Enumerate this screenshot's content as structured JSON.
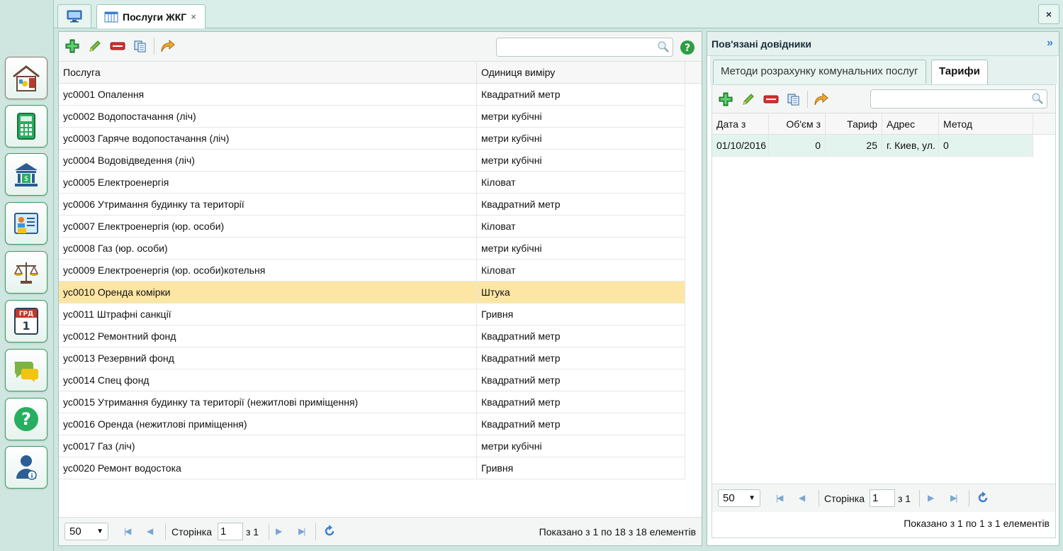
{
  "tabs": [
    {
      "label": ""
    },
    {
      "label": "Послуги ЖКГ",
      "close": "×"
    }
  ],
  "window": {
    "close": "×"
  },
  "sidebar": {
    "items": [
      {
        "name": "utilities"
      },
      {
        "name": "calculator"
      },
      {
        "name": "bank"
      },
      {
        "name": "id-card"
      },
      {
        "name": "scales"
      },
      {
        "name": "calendar",
        "cal_top": "ГРД",
        "cal_num": "1"
      },
      {
        "name": "chat"
      },
      {
        "name": "help",
        "glyph": "?"
      },
      {
        "name": "user-info"
      }
    ]
  },
  "services": {
    "columns": [
      "Послуга",
      "Одиниця виміру"
    ],
    "rows": [
      [
        "ус0001 Опалення",
        "Квадратний метр"
      ],
      [
        "ус0002 Водопостачання (ліч)",
        "метри кубічні"
      ],
      [
        "ус0003 Гаряче водопостачання (ліч)",
        "метри кубічні"
      ],
      [
        "ус0004 Водовідведення (ліч)",
        "метри кубічні"
      ],
      [
        "ус0005 Електроенергія",
        "Кіловат"
      ],
      [
        "ус0006 Утримання будинку та території",
        "Квадратний метр"
      ],
      [
        "ус0007 Електроенергія (юр. особи)",
        "Кіловат"
      ],
      [
        "ус0008 Газ (юр. особи)",
        "метри кубічні"
      ],
      [
        "ус0009 Електроенергія (юр. особи)котельня",
        "Кіловат"
      ],
      [
        "ус0010 Оренда комірки",
        "Штука"
      ],
      [
        "ус0011 Штрафні санкції",
        "Гривня"
      ],
      [
        "ус0012 Ремонтний фонд",
        "Квадратний метр"
      ],
      [
        "ус0013 Резервний фонд",
        "Квадратний метр"
      ],
      [
        "ус0014 Спец фонд",
        "Квадратний метр"
      ],
      [
        "ус0015 Утримання будинку та території (нежитлові приміщення)",
        "Квадратний метр"
      ],
      [
        "ус0016 Оренда (нежитлові приміщення)",
        "Квадратний метр"
      ],
      [
        "ус0017 Газ (ліч)",
        "метри кубічні"
      ],
      [
        "ус0020 Ремонт водостока",
        "Гривня"
      ]
    ],
    "selected_row": 9,
    "search": {
      "value": "",
      "placeholder": ""
    },
    "help": "?"
  },
  "pager": {
    "page_size": "50",
    "page_label": "Сторінка",
    "page": "1",
    "of_label": "з 1",
    "summary": "Показано з 1 по 18 з 18 елементів"
  },
  "related": {
    "title": "Пов'язані довідники",
    "collapse": "»",
    "tabs": [
      "Методи розрахунку комунальних послуг",
      "Тарифи"
    ],
    "columns": [
      "Дата з",
      "Об'єм з",
      "Тариф",
      "Адрес",
      "Метод"
    ],
    "rows": [
      [
        "01/10/2016",
        "0",
        "25",
        "г. Киев, ул.",
        "0"
      ]
    ],
    "pager": {
      "page_size": "50",
      "page_label": "Сторінка",
      "page": "1",
      "of_label": "з 1",
      "summary": "Показано з 1 по 1 з 1 елементів"
    }
  },
  "colors": {
    "accent": "#3a9b5d",
    "selection": "#fde6a4",
    "tariff_row": "#e3f4ef"
  }
}
